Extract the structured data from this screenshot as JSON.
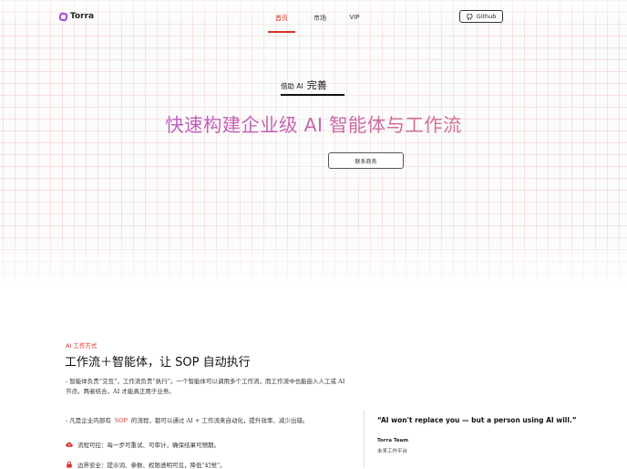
{
  "brand": {
    "name": "Torra"
  },
  "nav": {
    "home": "首页",
    "market": "市场",
    "vip": "VIP"
  },
  "github": {
    "label": "Github"
  },
  "hero": {
    "tag_small": "借助 AI",
    "tag_big": "完善",
    "headline": "快速构建企业级 AI 智能体与工作流",
    "cta": "联系商务"
  },
  "section": {
    "eyebrow": "AI 工作方式",
    "title": "工作流＋智能体，让 SOP 自动执行",
    "desc": "- 智能体负责“交互”，工作流负责“执行”。一个智能体可以调用多个工作流，而工作流中也能嵌入人工或 AI 节点。两者结合，AI 才能真正用于业务。",
    "sop_pre": "- 凡是企业内部有",
    "sop_hl": "SOP",
    "sop_post": "的流程，都可以通过 AI + 工作流来自动化，提升效率、减少出错。",
    "features": [
      {
        "icon": "cloud-icon",
        "text": "流程可控：每一步可重试、可审计，确保结果可预期。"
      },
      {
        "icon": "lock-icon",
        "text": "边界安全：提示词、参数、权限透明可见，降低“幻觉”。"
      }
    ]
  },
  "quote": {
    "text": "“AI won't replace you — but a person using AI will.”",
    "author": "Torra Team",
    "role": "未来工作平台"
  },
  "colors": {
    "accent": "#d9302c",
    "grad_start": "#a757cc",
    "grad_end": "#e08f6d"
  }
}
